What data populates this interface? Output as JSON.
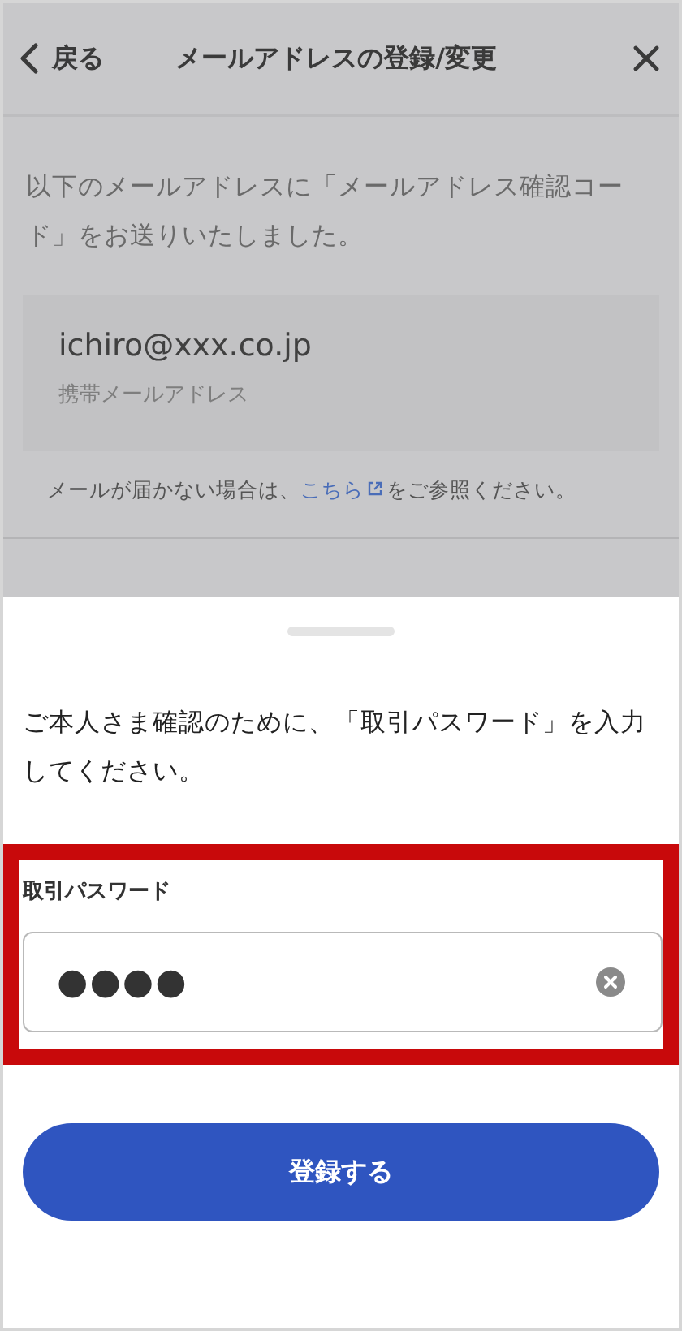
{
  "header": {
    "back_label": "戻る",
    "title": "メールアドレスの登録/変更"
  },
  "background": {
    "message": "以下のメールアドレスに「メールアドレス確認コード」をお送りいたしました。",
    "email": "ichiro@xxx.co.jp",
    "email_label": "携帯メールアドレス",
    "note_before": "メールが届かない場合は、",
    "note_link": "こちら",
    "note_after": "をご参照ください。"
  },
  "sheet": {
    "instruction": "ご本人さま確認のために、「取引パスワード」を入力してください。",
    "field_label": "取引パスワード",
    "field_value": "●●●●",
    "highlighted": true,
    "button": "登録する"
  }
}
